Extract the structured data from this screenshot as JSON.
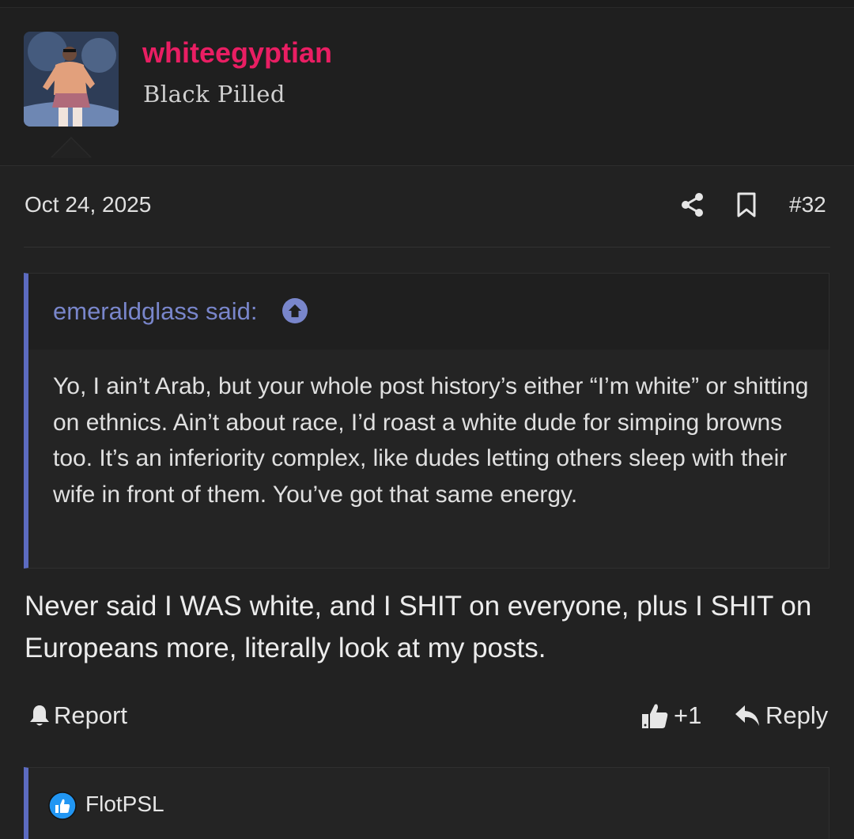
{
  "user": {
    "name": "whiteegyptian",
    "title": "Black Pilled"
  },
  "post": {
    "date": "Oct 24, 2025",
    "number": "#32",
    "quote": {
      "author": "emeraldglass said:",
      "text": "Yo, I ain’t Arab, but your whole post history’s either “I’m white” or shitting on ethnics. Ain’t about race, I’d roast a white dude for simping browns too. It’s an inferiority complex, like dudes letting others sleep with their wife in front of them. You’ve got that same energy."
    },
    "body": "Never said I WAS white, and I SHIT on everyone, plus I SHIT on Europeans more, literally look at my posts."
  },
  "actions": {
    "report_label": "Report",
    "like_label": "+1",
    "reply_label": "Reply"
  },
  "reactions": {
    "user": "FlotPSL"
  },
  "colors": {
    "username": "#e91e63",
    "accent": "#5c6bc0",
    "quote_author": "#7986cb",
    "background": "#222222"
  },
  "icons": [
    "share-icon",
    "bookmark-icon",
    "arrow-up-circle-icon",
    "bell-icon",
    "thumbs-up-icon",
    "reply-arrow-icon",
    "like-reaction-icon"
  ]
}
